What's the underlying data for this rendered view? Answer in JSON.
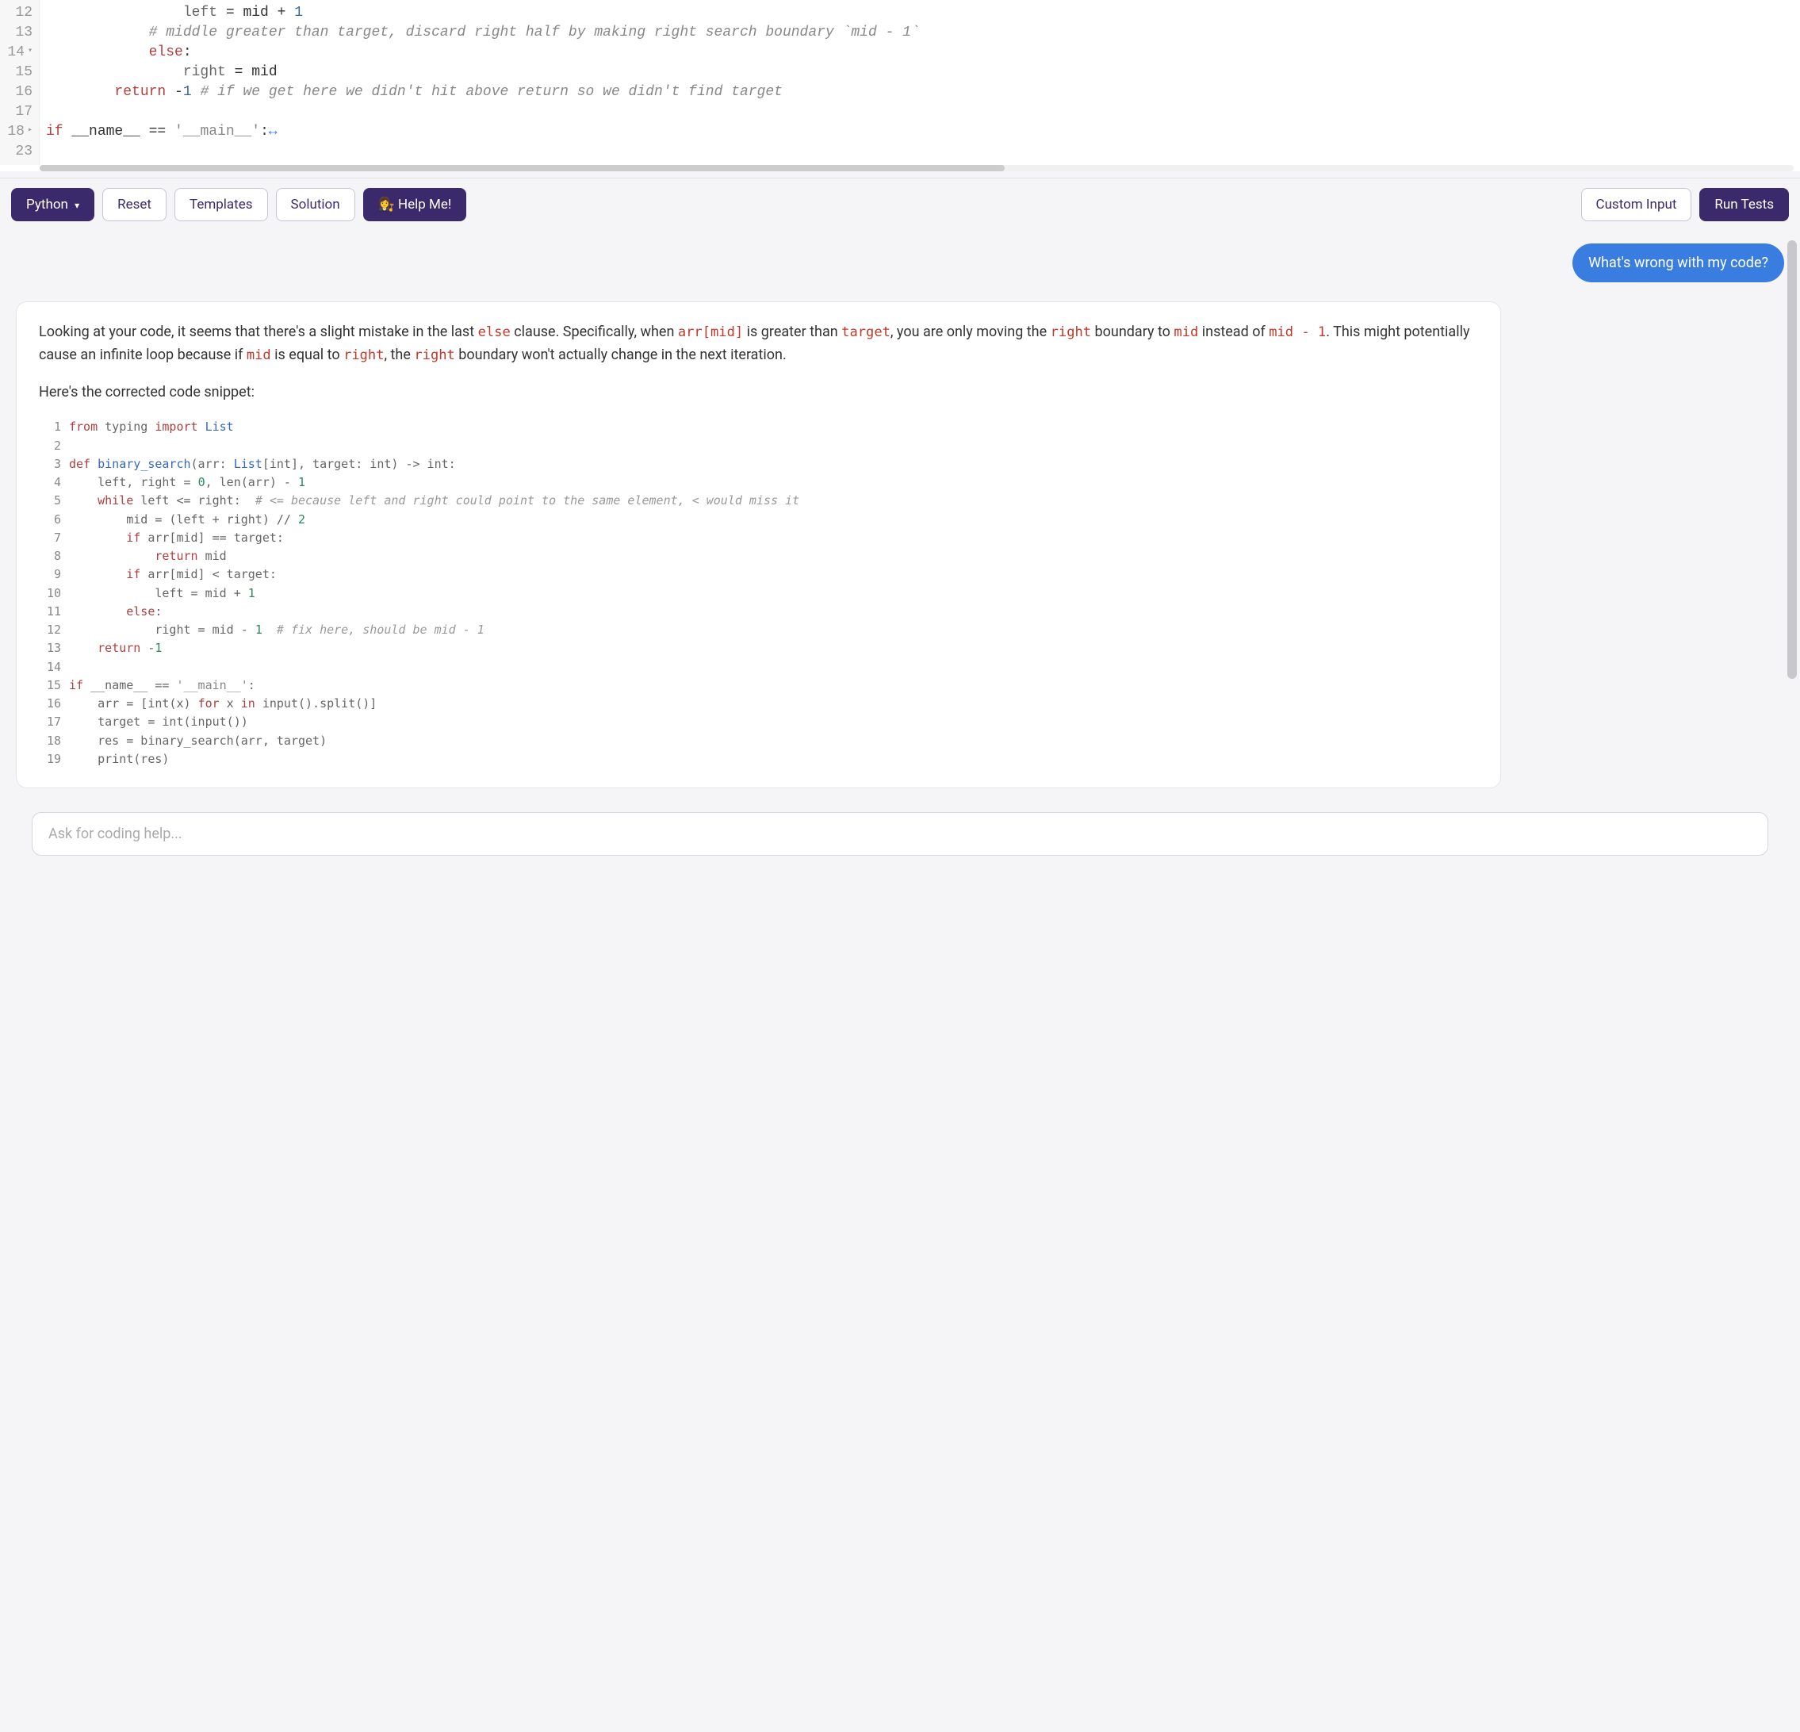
{
  "editor": {
    "lines": [
      {
        "num": "12",
        "fold": "",
        "indent": 4,
        "tokens": [
          [
            "name",
            "left"
          ],
          [
            "op",
            " = mid + "
          ],
          [
            "num",
            "1"
          ]
        ]
      },
      {
        "num": "13",
        "fold": "",
        "indent": 3,
        "tokens": [
          [
            "cmt",
            "# middle greater than target, discard right half by making right search boundary `mid - 1`"
          ]
        ]
      },
      {
        "num": "14",
        "fold": "▾",
        "indent": 3,
        "tokens": [
          [
            "kw",
            "else"
          ],
          [
            "op",
            ":"
          ]
        ]
      },
      {
        "num": "15",
        "fold": "",
        "indent": 4,
        "tokens": [
          [
            "name",
            "right"
          ],
          [
            "op",
            " = mid"
          ]
        ]
      },
      {
        "num": "16",
        "fold": "",
        "indent": 2,
        "tokens": [
          [
            "kw",
            "return"
          ],
          [
            "op",
            " -"
          ],
          [
            "num",
            "1"
          ],
          [
            "op",
            " "
          ],
          [
            "cmt",
            "# if we get here we didn't hit above return so we didn't find target"
          ]
        ]
      },
      {
        "num": "17",
        "fold": "",
        "indent": 0,
        "tokens": []
      },
      {
        "num": "18",
        "fold": "▸",
        "indent": 0,
        "tokens": [
          [
            "kw",
            "if"
          ],
          [
            "op",
            " __name__ == "
          ],
          [
            "str",
            "'__main__'"
          ],
          [
            "op",
            ":"
          ],
          [
            "fold",
            "↔"
          ]
        ]
      },
      {
        "num": "23",
        "fold": "",
        "indent": 0,
        "tokens": []
      }
    ]
  },
  "toolbar": {
    "language": "Python",
    "reset": "Reset",
    "templates": "Templates",
    "solution": "Solution",
    "help_emoji": "👩‍⚖️",
    "help": "Help Me!",
    "custom_input": "Custom Input",
    "run_tests": "Run Tests"
  },
  "chat": {
    "user_msg": "What's wrong with my code?",
    "assistant": {
      "p1_a": "Looking at your code, it seems that there's a slight mistake in the last ",
      "p1_else": "else",
      "p1_b": " clause. Specifically, when ",
      "p1_arrmid": "arr[mid]",
      "p1_c": " is greater than ",
      "p1_target": "target",
      "p1_d": ", you are only moving the ",
      "p1_right": "right",
      "p1_e": " boundary to ",
      "p1_mid": "mid",
      "p1_f": " instead of ",
      "p1_mid1": "mid - 1",
      "p1_g": ". This might potentially cause an infinite loop because if ",
      "p1_mid2": "mid",
      "p1_h": " is equal to ",
      "p1_right2": "right",
      "p1_i": ", the ",
      "p1_right3": "right",
      "p1_j": " boundary won't actually change in the next iteration.",
      "p2": "Here's the corrected code snippet:",
      "snippet": [
        {
          "n": "1",
          "raw": [
            [
              "kw",
              "from"
            ],
            [
              "op",
              " typing "
            ],
            [
              "kw",
              "import"
            ],
            [
              "op",
              " "
            ],
            [
              "cls",
              "List"
            ]
          ]
        },
        {
          "n": "2",
          "raw": []
        },
        {
          "n": "3",
          "raw": [
            [
              "kw",
              "def"
            ],
            [
              "op",
              " "
            ],
            [
              "fn",
              "binary_search"
            ],
            [
              "op",
              "(arr: "
            ],
            [
              "cls",
              "List"
            ],
            [
              "op",
              "[int], target: int) -> int:"
            ]
          ]
        },
        {
          "n": "4",
          "raw": [
            [
              "op",
              "    left, right = "
            ],
            [
              "num",
              "0"
            ],
            [
              "op",
              ", len(arr) - "
            ],
            [
              "num",
              "1"
            ]
          ]
        },
        {
          "n": "5",
          "raw": [
            [
              "op",
              "    "
            ],
            [
              "kw",
              "while"
            ],
            [
              "op",
              " left <= right:  "
            ],
            [
              "cmt",
              "# <= because left and right could point to the same element, < would miss it"
            ]
          ]
        },
        {
          "n": "6",
          "raw": [
            [
              "op",
              "        mid = (left + right) // "
            ],
            [
              "num",
              "2"
            ]
          ]
        },
        {
          "n": "7",
          "raw": [
            [
              "op",
              "        "
            ],
            [
              "kw",
              "if"
            ],
            [
              "op",
              " arr[mid] == target:"
            ]
          ]
        },
        {
          "n": "8",
          "raw": [
            [
              "op",
              "            "
            ],
            [
              "kw",
              "return"
            ],
            [
              "op",
              " mid"
            ]
          ]
        },
        {
          "n": "9",
          "raw": [
            [
              "op",
              "        "
            ],
            [
              "kw",
              "if"
            ],
            [
              "op",
              " arr[mid] < target:"
            ]
          ]
        },
        {
          "n": "10",
          "raw": [
            [
              "op",
              "            left = mid + "
            ],
            [
              "num",
              "1"
            ]
          ]
        },
        {
          "n": "11",
          "raw": [
            [
              "op",
              "        "
            ],
            [
              "kw",
              "else"
            ],
            [
              "op",
              ":"
            ]
          ]
        },
        {
          "n": "12",
          "raw": [
            [
              "op",
              "            right = mid - "
            ],
            [
              "num",
              "1"
            ],
            [
              "op",
              "  "
            ],
            [
              "cmt",
              "# fix here, should be mid - 1"
            ]
          ]
        },
        {
          "n": "13",
          "raw": [
            [
              "op",
              "    "
            ],
            [
              "kw",
              "return"
            ],
            [
              "op",
              " -"
            ],
            [
              "num",
              "1"
            ]
          ]
        },
        {
          "n": "14",
          "raw": []
        },
        {
          "n": "15",
          "raw": [
            [
              "kw",
              "if"
            ],
            [
              "op",
              " __name__ == "
            ],
            [
              "str",
              "'__main__'"
            ],
            [
              "op",
              ":"
            ]
          ]
        },
        {
          "n": "16",
          "raw": [
            [
              "op",
              "    arr = [int(x) "
            ],
            [
              "kw",
              "for"
            ],
            [
              "op",
              " x "
            ],
            [
              "kw",
              "in"
            ],
            [
              "op",
              " input().split()]"
            ]
          ]
        },
        {
          "n": "17",
          "raw": [
            [
              "op",
              "    target = int(input())"
            ]
          ]
        },
        {
          "n": "18",
          "raw": [
            [
              "op",
              "    res = binary_search(arr, target)"
            ]
          ]
        },
        {
          "n": "19",
          "raw": [
            [
              "op",
              "    print(res)"
            ]
          ]
        }
      ]
    }
  },
  "input": {
    "placeholder": "Ask for coding help..."
  }
}
